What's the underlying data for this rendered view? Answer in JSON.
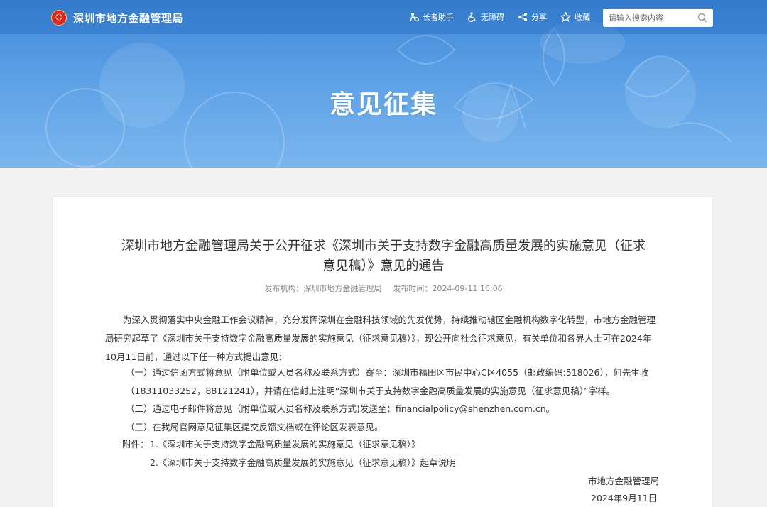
{
  "header": {
    "site_name": "深圳市地方金融管理局",
    "tools": [
      {
        "icon": "elder-assistant-icon",
        "label": "长者助手"
      },
      {
        "icon": "accessibility-icon",
        "label": "无障碍"
      },
      {
        "icon": "share-icon",
        "label": "分享"
      },
      {
        "icon": "star-icon",
        "label": "收藏"
      }
    ],
    "search_placeholder": "请输入搜索内容"
  },
  "banner": {
    "title": "意见征集"
  },
  "article": {
    "title_line1": "深圳市地方金融管理局关于公开征求《深圳市关于支持数字金融高质量发展的实施意见（征求",
    "title_line2": "意见稿）》意见的通告",
    "meta": {
      "publisher_label": "发布机构：",
      "publisher": "深圳市地方金融管理局",
      "time_label": "发布时间：",
      "time": "2024-09-11 16:06"
    },
    "intro": "为深入贯彻落实中央金融工作会议精神，充分发挥深圳在金融科技领域的先发优势，持续推动辖区金融机构数字化转型，市地方金融管理局研究起草了《深圳市关于支持数字金融高质量发展的实施意见（征求意见稿）》，现公开向社会征求意见，有关单位和各界人士可在2024年10月11日前，通过以下任一种方式提出意见:",
    "method1": "（一）通过信函方式将意见（附单位或人员名称及联系方式）寄至：深圳市福田区市民中心C区4055（邮政编码:518026），何先生收（18311033252，88121241），并请在信封上注明“深圳市关于支持数字金融高质量发展的实施意见（征求意见稿）”字样。",
    "method2": "（二）通过电子邮件将意见（附单位或人员名称及联系方式)发送至：financialpolicy@shenzhen.com.cn。",
    "method3": "（三）在我局官网意见征集区提交反馈文档或在评论区发表意见。",
    "attachment_label": "附件：",
    "attachment1": "1.《深圳市关于支持数字金融高质量发展的实施意见（征求意见稿）》",
    "attachment2": "2.《深圳市关于支持数字金融高质量发展的实施意见（征求意见稿）》起草说明",
    "signature": "市地方金融管理局",
    "date": "2024年9月11日"
  }
}
